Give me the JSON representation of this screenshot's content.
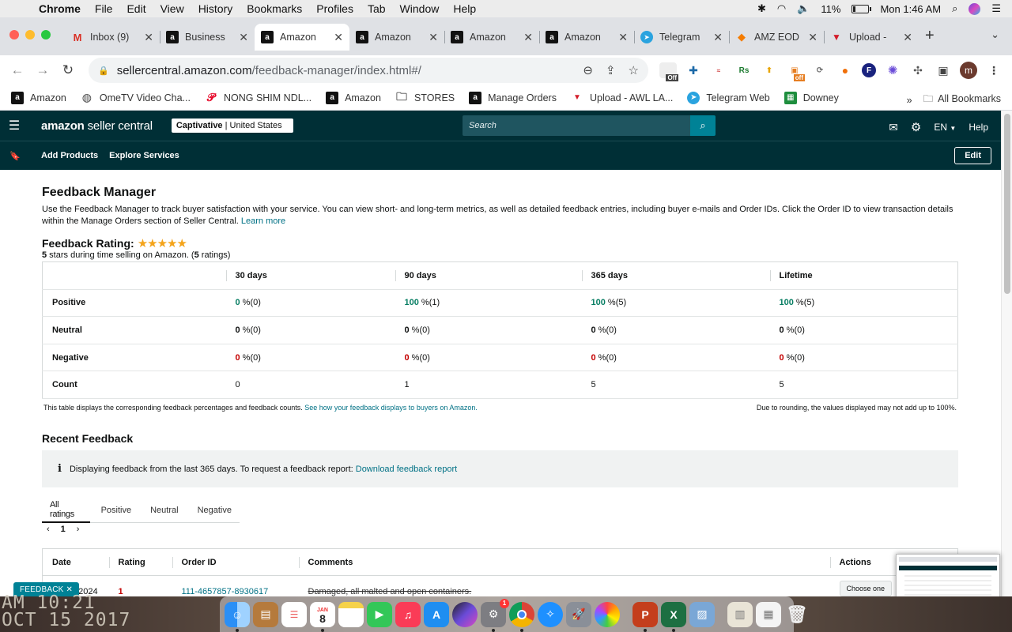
{
  "menubar": {
    "app": "Chrome",
    "items": [
      "File",
      "Edit",
      "View",
      "History",
      "Bookmarks",
      "Profiles",
      "Tab",
      "Window",
      "Help"
    ],
    "battery": "11%",
    "clock": "Mon 1:46 AM"
  },
  "tabs": [
    {
      "label": "Inbox (9)",
      "icon": "gmail-icon"
    },
    {
      "label": "Business",
      "icon": "amazon-icon"
    },
    {
      "label": "Amazon",
      "icon": "amazon-icon",
      "active": true
    },
    {
      "label": "Amazon",
      "icon": "amazon-icon"
    },
    {
      "label": "Amazon",
      "icon": "amazon-icon"
    },
    {
      "label": "Amazon",
      "icon": "amazon-icon"
    },
    {
      "label": "Telegram",
      "icon": "telegram-icon"
    },
    {
      "label": "AMZ EOD",
      "icon": "eod-icon"
    },
    {
      "label": "Upload -",
      "icon": "upload-icon"
    }
  ],
  "address": {
    "host": "sellercentral.amazon.com",
    "path": "/feedback-manager/index.html#/"
  },
  "extensions": {
    "off_badge": "Off",
    "off_badge2": "off",
    "profile_initial": "m"
  },
  "bookmarks": {
    "items": [
      {
        "label": "Amazon",
        "icon": "amazon-icon"
      },
      {
        "label": "OmeTV Video Cha...",
        "icon": "globe-icon"
      },
      {
        "label": "NONG SHIM NDL...",
        "icon": "pinterest-icon"
      },
      {
        "label": "Amazon",
        "icon": "amazon-icon"
      },
      {
        "label": "STORES",
        "icon": "folder-icon"
      },
      {
        "label": "Manage Orders",
        "icon": "amazon-icon"
      },
      {
        "label": "Upload - AWL LA...",
        "icon": "upload-icon"
      },
      {
        "label": "Telegram Web",
        "icon": "telegram-icon"
      },
      {
        "label": "Downey",
        "icon": "sheets-icon"
      }
    ],
    "overflow": "»",
    "all": "All Bookmarks"
  },
  "header": {
    "logo_brand": "amazon",
    "logo_suffix": " seller central",
    "account_store": "Captivative",
    "account_region": " | United States",
    "search_placeholder": "Search",
    "language": "EN",
    "help": "Help"
  },
  "subnav": {
    "add_products": "Add Products",
    "explore_services": "Explore Services",
    "edit": "Edit"
  },
  "page": {
    "title": "Feedback Manager",
    "intro": "Use the Feedback Manager to track buyer satisfaction with your service. You can view short- and long-term metrics, as well as detailed feedback entries, including buyer e-mails and Order IDs. Click the Order ID to view transaction details within the Manage Orders section of Seller Central.",
    "learn_more": "Learn more",
    "rating_label": "Feedback Rating:",
    "stars": "★★★★★",
    "rating_stars": "5",
    "rating_mid": " stars during time selling on Amazon. (",
    "rating_count": "5",
    "rating_end": " ratings)"
  },
  "feedback_table": {
    "headers": [
      "30 days",
      "90 days",
      "365 days",
      "Lifetime"
    ],
    "rows": [
      {
        "label": "Positive",
        "cells": [
          [
            "0",
            " %(0)"
          ],
          [
            "100",
            " %(1)"
          ],
          [
            "100",
            " %(5)"
          ],
          [
            "100",
            " %(5)"
          ]
        ]
      },
      {
        "label": "Neutral",
        "cells": [
          [
            "0",
            " %(0)"
          ],
          [
            "0",
            " %(0)"
          ],
          [
            "0",
            " %(0)"
          ],
          [
            "0",
            " %(0)"
          ]
        ]
      },
      {
        "label": "Negative",
        "cells": [
          [
            "0",
            " %(0)"
          ],
          [
            "0",
            " %(0)"
          ],
          [
            "0",
            " %(0)"
          ],
          [
            "0",
            " %(0)"
          ]
        ]
      },
      {
        "label": "Count",
        "cells": [
          [
            "",
            "0"
          ],
          [
            "",
            "1"
          ],
          [
            "",
            "5"
          ],
          [
            "",
            "5"
          ]
        ]
      }
    ],
    "note_left": "This table displays the corresponding feedback percentages and feedback counts.",
    "note_link": "See how your feedback displays to buyers on Amazon.",
    "note_right": "Due to rounding, the values displayed may not add up to 100%."
  },
  "recent": {
    "title": "Recent Feedback",
    "info": "Displaying feedback from the last 365 days. To request a feedback report:",
    "info_link": "Download feedback report",
    "tabs": [
      "All ratings",
      "Positive",
      "Neutral",
      "Negative"
    ],
    "page": "1",
    "columns": [
      "Date",
      "Rating",
      "Order ID",
      "Comments",
      "Actions"
    ],
    "rows": [
      {
        "date": "4/2024",
        "rating": "1",
        "order_id": "111-4657857-8930617",
        "comment": "Damaged, all malted and open containers.",
        "action": "Choose one"
      }
    ]
  },
  "feedback_badge": "FEEDBACK ✕",
  "desktop_clock": {
    "line1": "AM 10:21",
    "line2": "OCT 15 2017"
  },
  "dock": {
    "calendar_month": "JAN",
    "calendar_day": "8",
    "badge": "1"
  }
}
